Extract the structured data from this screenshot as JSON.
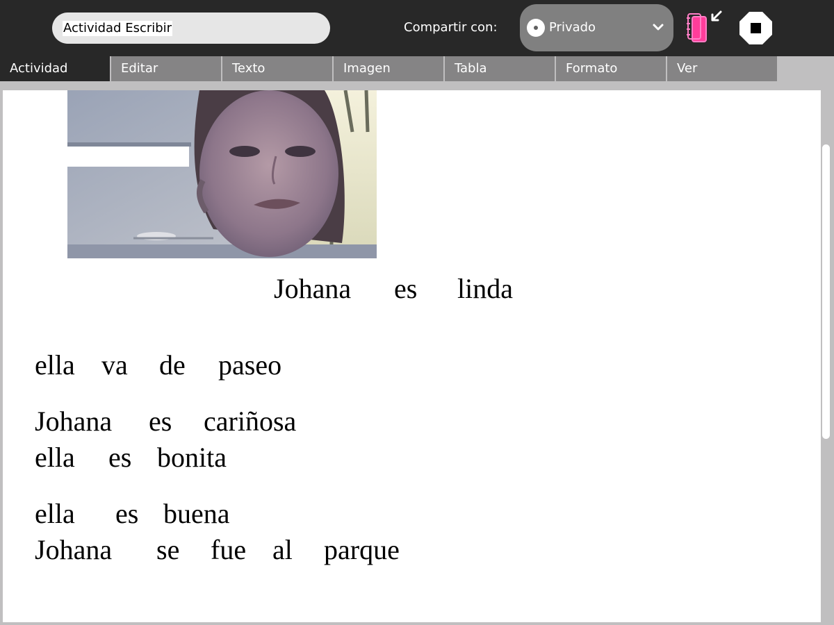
{
  "toolbar": {
    "activity_title": "Actividad Escribir",
    "share_label": "Compartir con:",
    "share_value": "Privado",
    "journal_icon": "journal-keep-icon",
    "stop_icon": "stop-icon"
  },
  "tabs": [
    {
      "label": "Actividad",
      "active": true
    },
    {
      "label": "Editar",
      "active": false
    },
    {
      "label": "Texto",
      "active": false
    },
    {
      "label": "Imagen",
      "active": false
    },
    {
      "label": "Tabla",
      "active": false
    },
    {
      "label": "Formato",
      "active": false
    },
    {
      "label": "Ver",
      "active": false
    }
  ],
  "document": {
    "lines": [
      {
        "words": [
          "Johana",
          "es",
          "linda"
        ]
      },
      {
        "words": [
          "ella",
          "va",
          "de",
          "paseo"
        ]
      },
      {
        "words": [
          "Johana",
          "es",
          "cariñosa"
        ]
      },
      {
        "words": [
          "ella",
          "es",
          "bonita"
        ]
      },
      {
        "words": [
          "ella",
          "es",
          "buena"
        ]
      },
      {
        "words": [
          "Johana",
          "se",
          "fue",
          "al",
          "parque"
        ]
      }
    ]
  },
  "colors": {
    "toolbar_bg": "#282828",
    "tab_inactive": "#858485",
    "tab_active": "#282828",
    "canvas_bg": "#c0bfc0",
    "journal_accent": "#ff4fa3"
  }
}
